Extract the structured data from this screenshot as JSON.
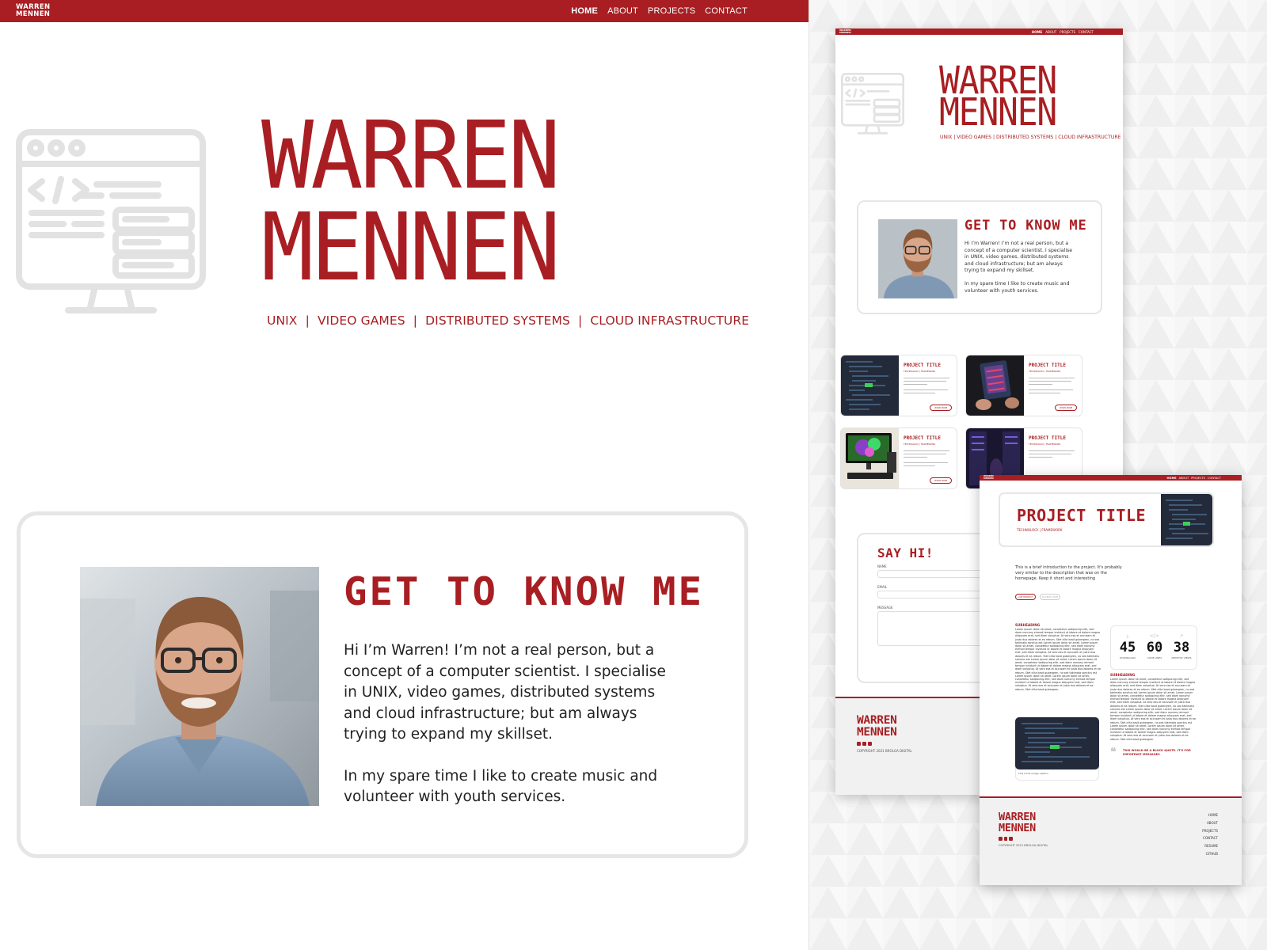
{
  "nav": {
    "logo_line1": "WARREN",
    "logo_line2": "MENNEN",
    "links": [
      "HOME",
      "ABOUT",
      "PROJECTS",
      "CONTACT"
    ]
  },
  "hero": {
    "name_line1": "WARREN",
    "name_line2": "MENNEN",
    "tags": "UNIX  |  VIDEO GAMES  |  DISTRIBUTED SYSTEMS  |  CLOUD INFRASTRUCTURE",
    "icon": "computer-code-icon"
  },
  "about": {
    "heading": "GET TO KNOW ME",
    "paragraph1": "Hi I’m Warren! I’m not a real person, but a concept of a computer scientist. I specialise in UNIX, video games, distributed systems and cloud infrastructure; but am always trying to expand my skillset.",
    "paragraph2": "In my spare time I like to create music and volunteer with youth services.",
    "photo": "portrait-photo"
  },
  "mini_page": {
    "tags": "UNIX | VIDEO GAMES | DISTRIBUTED SYSTEMS | CLOUD INFRASTRUCTURE",
    "projects": [
      {
        "title": "PROJECT TITLE",
        "subtitle": "TECHNOLOGY | FRAMEWORK",
        "button": "LEARN MORE"
      },
      {
        "title": "PROJECT TITLE",
        "subtitle": "TECHNOLOGY | FRAMEWORK",
        "button": "LEARN MORE"
      },
      {
        "title": "PROJECT TITLE",
        "subtitle": "TECHNOLOGY | FRAMEWORK",
        "button": "LEARN MORE"
      },
      {
        "title": "PROJECT TITLE",
        "subtitle": "TECHNOLOGY | FRAMEWORK",
        "button": "LEARN MORE"
      }
    ],
    "contact": {
      "heading": "SAY HI!",
      "name_label": "NAME",
      "email_label": "EMAIL",
      "message_label": "MESSAGE"
    },
    "footer": {
      "name_line1": "WARREN",
      "name_line2": "MENNEN",
      "copyright": "COPYRIGHT 2021 BROLGA DIGITAL"
    }
  },
  "project_page": {
    "title": "PROJECT TITLE",
    "subtitle": "TECHNOLOGY | FRAMEWORK",
    "intro": "This is a brief introduction to the project. It's probably very similar to the description that was on the homepage. Keep it short and interesting",
    "button_live": "LIVE PROJECT",
    "button_source": "SOURCE CODE",
    "subheading": "SUBHEADING",
    "lorem": "Lorem ipsum dolor sit amet, consetetur sadipscing elitr, sed diam nonumy eirmod tempor invidunt ut labore et dolore magna aliquyam erat, sed diam voluptua. At vero eos et accusam et justo duo dolores et ea rebum. Stet clita kasd gubergren, no sea takimata sanctus est Lorem ipsum dolor sit amet. Lorem ipsum dolor sit amet, consetetur sadipscing elitr, sed diam nonumy eirmod tempor invidunt ut labore et dolore magna aliquyam erat, sed diam voluptua. At vero eos et accusam et justo duo dolores et ea rebum. Stet clita kasd gubergren, no sea takimata sanctus est Lorem ipsum dolor sit amet. Lorem ipsum dolor sit amet, consetetur sadipscing elitr, sed diam nonumy eirmod tempor invidunt ut labore et dolore magna aliquyam erat, sed diam voluptua. At vero eos et accusam et justo duo dolores et ea rebum. Stet clita kasd gubergren, no sea takimata sanctus est Lorem ipsum dolor sit amet. Lorem ipsum dolor sit amet, consetetur sadipscing elitr, sed diam nonumy eirmod tempor invidunt ut labore et dolore magna aliquyam erat, sed diam voluptua. At vero eos et accusam et justo duo dolores et ea rebum. Stet clita kasd gubergren.",
    "stats": [
      {
        "value": "45",
        "label": "DOWNLOADS",
        "icon": "download-icon"
      },
      {
        "value": "60",
        "label": "CODE LINES",
        "icon": "code-icon"
      },
      {
        "value": "38",
        "label": "MONTHLY VIEWS",
        "icon": "chart-icon"
      }
    ],
    "caption": "This is the image caption",
    "quote": "THIS WOULD BE A BLOCK QUOTE. IT'S FOR IMPORTANT MESSAGES",
    "footer": {
      "name_line1": "WARREN",
      "name_line2": "MENNEN",
      "copyright": "COPYRIGHT 2021 BROLGA DIGITAL",
      "links": [
        "HOME",
        "ABOUT",
        "PROJECTS",
        "CONTACT",
        "RESUME",
        "GITHUB"
      ]
    }
  },
  "colors": {
    "brand_red": "#a81e22",
    "card_border": "#e6e6e6",
    "footer_bg": "#f1f1f1"
  }
}
